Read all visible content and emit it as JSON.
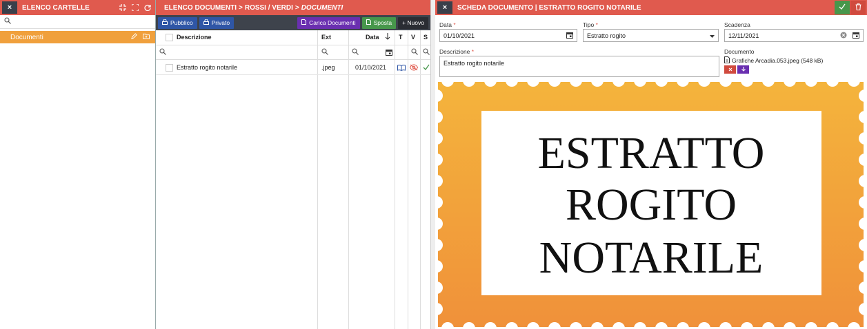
{
  "left_panel": {
    "close_icon": "×",
    "title": "ELENCO CARTELLE",
    "folders": [
      {
        "label": "Documenti"
      }
    ]
  },
  "middle_panel": {
    "close_icon": "×",
    "breadcrumb": {
      "root": "ELENCO DOCUMENTI",
      "sep1": ">",
      "path": "ROSSI / VERDI",
      "sep2": ">",
      "current": "DOCUMENTI"
    },
    "buttons": {
      "public": "Pubblico",
      "private": "Privato",
      "upload": "Carica Documenti",
      "move": "Sposta",
      "new": "+ Nuovo"
    },
    "columns": {
      "description": "Descrizione",
      "ext": "Ext",
      "date": "Data",
      "t": "T",
      "v": "V",
      "s": "S"
    },
    "rows": [
      {
        "description": "Estratto rogito notarile",
        "ext": ".jpeg",
        "date": "01/10/2021"
      }
    ]
  },
  "right_panel": {
    "title": "SCHEDA DOCUMENTO | ESTRATTO ROGITO NOTARILE",
    "fields": {
      "data_label": "Data",
      "data_value": "01/10/2021",
      "tipo_label": "Tipo",
      "tipo_value": "Estratto rogito",
      "scadenza_label": "Scadenza",
      "scadenza_value": "12/11/2021",
      "descrizione_label": "Descrizione",
      "descrizione_value": "Estratto rogito notarile",
      "documento_label": "Documento",
      "documento_file": "Grafiche Arcadia.053.jpeg (548 kB)",
      "required_mark": "*"
    },
    "preview_text": {
      "line1": "ESTRATTO",
      "line2": "ROGITO",
      "line3": "NOTARILE"
    }
  },
  "colors": {
    "header": "#e05a4e",
    "accent_orange": "#f0a03c",
    "dark": "#3e434c",
    "blue": "#2f56a6",
    "purple": "#6a2fb0",
    "green": "#47974b"
  }
}
